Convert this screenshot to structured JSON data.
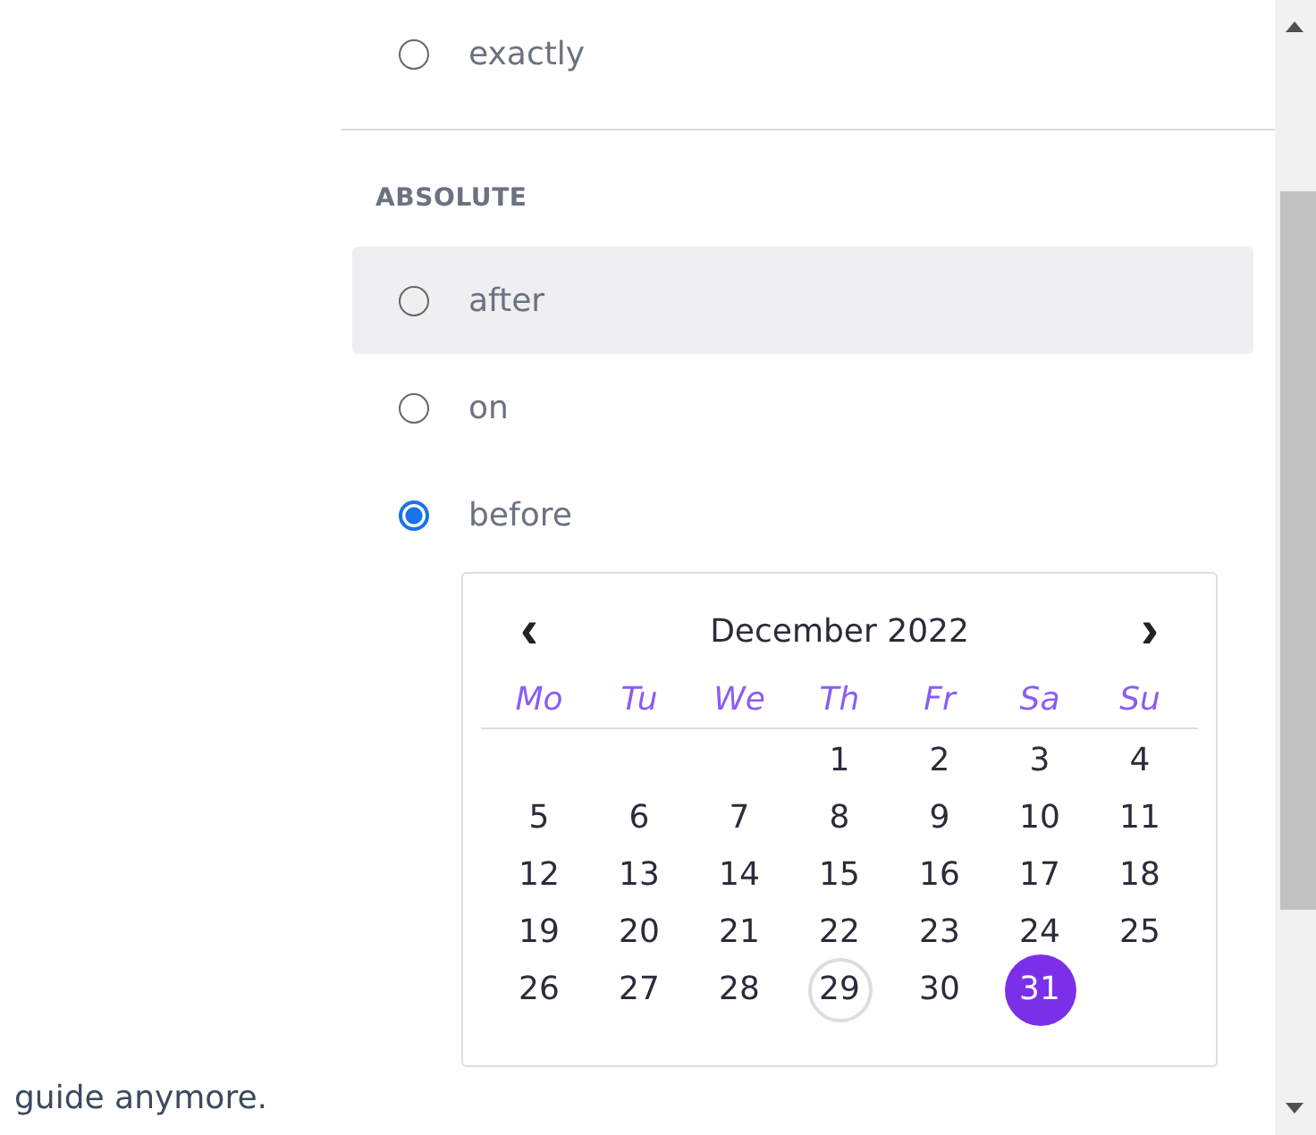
{
  "page_text": "guide anymore.",
  "relative_options": [
    {
      "label": "exactly",
      "selected": false
    }
  ],
  "absolute": {
    "heading": "ABSOLUTE",
    "options": [
      {
        "label": "after",
        "selected": false,
        "hovered": true
      },
      {
        "label": "on",
        "selected": false,
        "hovered": false
      },
      {
        "label": "before",
        "selected": true,
        "hovered": false
      }
    ]
  },
  "calendar": {
    "prev": "‹",
    "next": "›",
    "title": "December 2022",
    "weekdays": [
      "Mo",
      "Tu",
      "We",
      "Th",
      "Fr",
      "Sa",
      "Su"
    ],
    "weeks": [
      [
        {
          "day": "1",
          "selected": false,
          "today": false
        },
        {
          "day": "2",
          "selected": false,
          "today": false
        },
        {
          "day": "3",
          "selected": false,
          "today": false
        },
        {
          "day": "4",
          "selected": false,
          "today": false
        }
      ],
      [
        {
          "day": "5",
          "selected": false,
          "today": false
        },
        {
          "day": "6",
          "selected": false,
          "today": false
        },
        {
          "day": "7",
          "selected": false,
          "today": false
        },
        {
          "day": "8",
          "selected": false,
          "today": false
        },
        {
          "day": "9",
          "selected": false,
          "today": false
        },
        {
          "day": "10",
          "selected": false,
          "today": false
        },
        {
          "day": "11",
          "selected": false,
          "today": false
        }
      ],
      [
        {
          "day": "12",
          "selected": false,
          "today": false
        },
        {
          "day": "13",
          "selected": false,
          "today": false
        },
        {
          "day": "14",
          "selected": false,
          "today": false
        },
        {
          "day": "15",
          "selected": false,
          "today": false
        },
        {
          "day": "16",
          "selected": false,
          "today": false
        },
        {
          "day": "17",
          "selected": false,
          "today": false
        },
        {
          "day": "18",
          "selected": false,
          "today": false
        }
      ],
      [
        {
          "day": "19",
          "selected": false,
          "today": false
        },
        {
          "day": "20",
          "selected": false,
          "today": false
        },
        {
          "day": "21",
          "selected": false,
          "today": false
        },
        {
          "day": "22",
          "selected": false,
          "today": false
        },
        {
          "day": "23",
          "selected": false,
          "today": false
        },
        {
          "day": "24",
          "selected": false,
          "today": false
        },
        {
          "day": "25",
          "selected": false,
          "today": false
        }
      ],
      [
        {
          "day": "26",
          "selected": false,
          "today": false
        },
        {
          "day": "27",
          "selected": false,
          "today": false
        },
        {
          "day": "28",
          "selected": false,
          "today": false
        },
        {
          "day": "29",
          "selected": false,
          "today": true
        },
        {
          "day": "30",
          "selected": false,
          "today": false
        },
        {
          "day": "31",
          "selected": true,
          "today": false
        }
      ]
    ]
  }
}
